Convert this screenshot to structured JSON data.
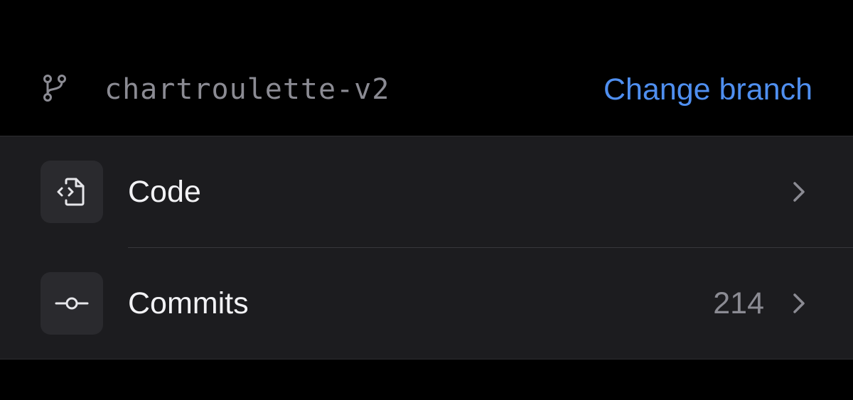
{
  "branch": {
    "icon": "git-branch-icon",
    "name": "chartroulette-v2",
    "change_label": "Change branch"
  },
  "rows": [
    {
      "label": "Code",
      "icon": "code-file-icon",
      "count": null,
      "chevron": "chevron-right-icon"
    },
    {
      "label": "Commits",
      "icon": "git-commit-icon",
      "count": "214",
      "chevron": "chevron-right-icon"
    }
  ],
  "colors": {
    "background": "#000000",
    "group_background": "#1c1c1f",
    "icon_tile": "#2a2a2e",
    "accent": "#4f8ff0",
    "primary_text": "#f2f2f5",
    "secondary_text": "#8b8b93"
  }
}
